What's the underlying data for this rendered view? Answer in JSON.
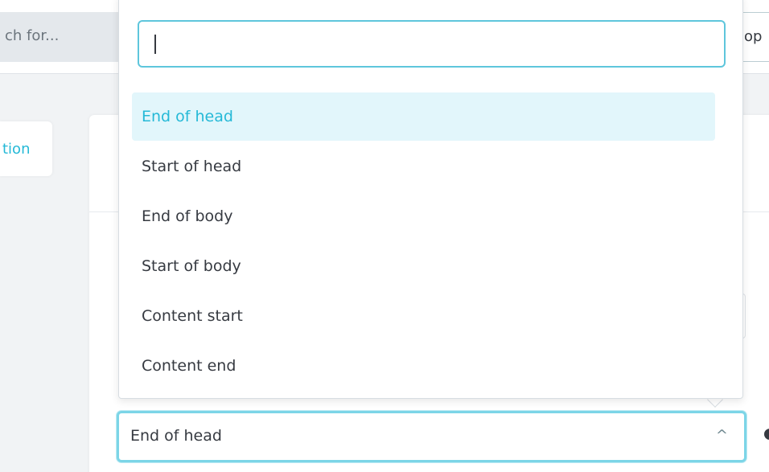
{
  "header": {
    "search_placeholder": "ch for...",
    "shop_label": "op"
  },
  "left_tab": {
    "label": "tion"
  },
  "select": {
    "value": "End of head",
    "caret": "^"
  },
  "dropdown": {
    "search_value": "",
    "options": [
      {
        "label": "End of head",
        "active": true
      },
      {
        "label": "Start of head",
        "active": false
      },
      {
        "label": "End of body",
        "active": false
      },
      {
        "label": "Start of body",
        "active": false
      },
      {
        "label": "Content start",
        "active": false
      },
      {
        "label": "Content end",
        "active": false
      }
    ]
  },
  "colors": {
    "accent": "#25b9d7",
    "active_bg": "#e2f6fb",
    "focus_border": "#7cd5e7"
  }
}
